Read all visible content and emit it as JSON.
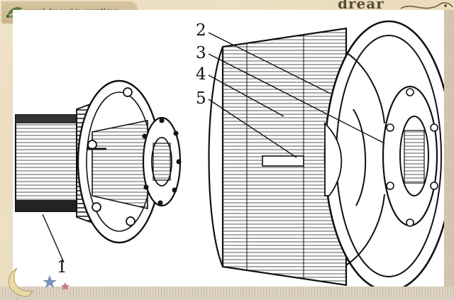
{
  "banner": {
    "text": "search for soul in everything.",
    "icon": "leaf-icon"
  },
  "corner": {
    "text": "drear"
  },
  "diagram": {
    "labels": [
      {
        "id": "label-1",
        "text": "1"
      },
      {
        "id": "label-2",
        "text": "2"
      },
      {
        "id": "label-3",
        "text": "3"
      },
      {
        "id": "label-4",
        "text": "4"
      },
      {
        "id": "label-5",
        "text": "5"
      }
    ]
  },
  "decor": {
    "moon_icon": "crescent-moon-icon",
    "star_icon": "star-icon",
    "accent": "#efe3c7"
  }
}
